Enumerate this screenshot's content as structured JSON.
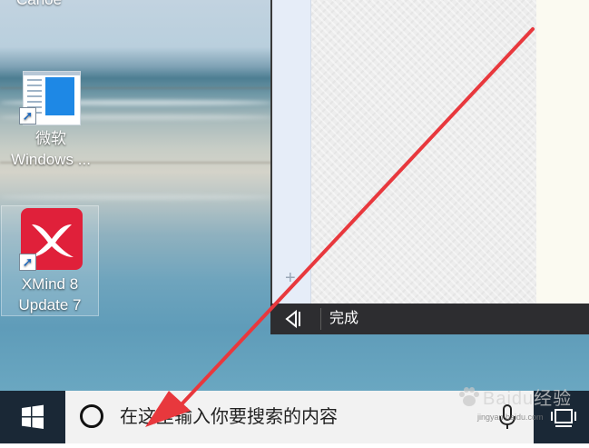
{
  "desktop": {
    "top_clip_text": "Canoe",
    "icons": [
      {
        "label_line1": "微软",
        "label_line2": "Windows ..."
      },
      {
        "label_line1": "XMind 8",
        "label_line2": "Update 7"
      }
    ]
  },
  "app_window": {
    "plus_symbol": "+",
    "done_label": "完成"
  },
  "taskbar": {
    "search_placeholder": "在这里输入你要搜索的内容"
  },
  "watermark": {
    "text": "Baidu经验",
    "subtext": "jingyan.baidu.com"
  },
  "colors": {
    "taskbar_bg": "#1a2836",
    "search_bg": "#f2f2f2",
    "done_bar_bg": "#2d2d30",
    "annotation_arrow": "#e8383d",
    "xmind_red": "#e0203a"
  },
  "icons": {
    "start": "windows-logo-icon",
    "search": "cortana-circle-icon",
    "mic": "microphone-icon",
    "task_view": "task-view-icon",
    "back": "panel-back-icon"
  }
}
